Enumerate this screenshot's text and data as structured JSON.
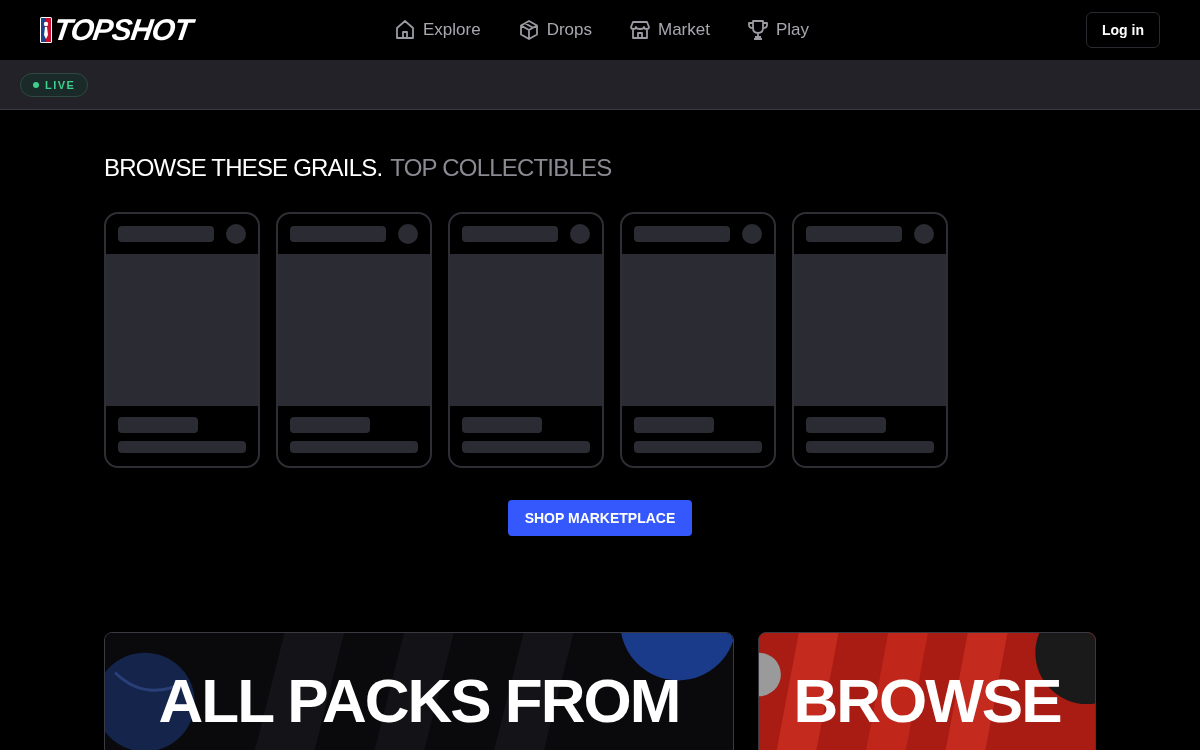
{
  "header": {
    "logo": "TOPSHOT",
    "nav": [
      {
        "label": "Explore",
        "kind": "home"
      },
      {
        "label": "Drops",
        "kind": "box"
      },
      {
        "label": "Market",
        "kind": "store"
      },
      {
        "label": "Play",
        "kind": "trophy"
      }
    ],
    "login": "Log in"
  },
  "live_bar": {
    "badge": "LIVE"
  },
  "section": {
    "title": "BROWSE THESE GRAILS.",
    "subtitle": "TOP COLLECTIBLES"
  },
  "cards": [
    {
      "kind": "skeleton"
    },
    {
      "kind": "skeleton"
    },
    {
      "kind": "skeleton"
    },
    {
      "kind": "skeleton"
    },
    {
      "kind": "skeleton"
    }
  ],
  "shop_button": "SHOP MARKETPLACE",
  "banners": [
    {
      "kind": "packs",
      "lines": [
        "ALL PACKS FROM"
      ]
    },
    {
      "kind": "browse",
      "lines": [
        "BROWSE"
      ]
    }
  ]
}
